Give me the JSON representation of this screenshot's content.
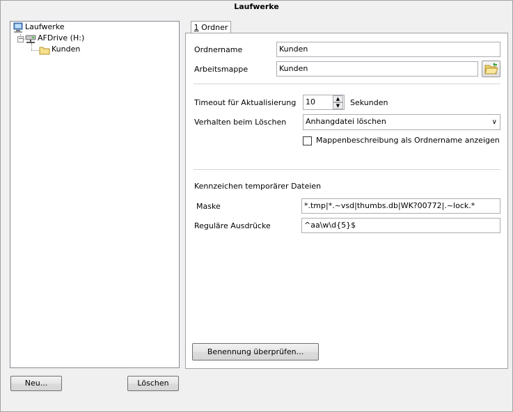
{
  "window": {
    "title": "Laufwerke"
  },
  "tree": {
    "root": "Laufwerke",
    "drive": "AFDrive (H:)",
    "folder": "Kunden"
  },
  "buttons": {
    "new": "Neu...",
    "delete": "Löschen",
    "check_naming": "Benennung überprüfen..."
  },
  "tabs": [
    {
      "mnemonic": "1",
      "label": " Ordner"
    }
  ],
  "form": {
    "folder_name": {
      "label": "Ordnername",
      "value": "Kunden"
    },
    "workspace": {
      "label": "Arbeitsmappe",
      "value": "Kunden"
    },
    "timeout": {
      "label": "Timeout für Aktualisierung",
      "value": "10",
      "unit": "Sekunden"
    },
    "delete_behavior": {
      "label": "Verhalten beim Löschen",
      "value": "Anhangdatei löschen"
    },
    "checkbox": {
      "label": "Mappenbeschreibung als Ordnername anzeigen",
      "checked": false
    },
    "temp_section": "Kennzeichen temporärer Dateien",
    "mask": {
      "label": "Maske",
      "value": "*.tmp|*.~vsd|thumbs.db|WK?00772|.~lock.*"
    },
    "regex": {
      "label": "Reguläre Ausdrücke",
      "value": "^aa\\w\\d{5}$"
    }
  },
  "colors": {
    "panel_bg": "#ffffff",
    "window_bg": "#f0f0f0",
    "border": "#a0a0a0"
  }
}
